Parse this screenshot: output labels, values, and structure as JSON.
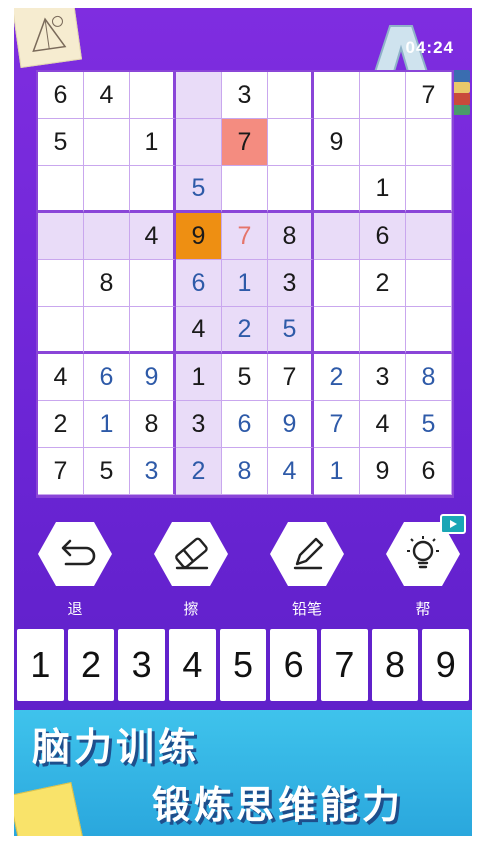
{
  "timer": "04:24",
  "grid": [
    [
      {
        "v": "6"
      },
      {
        "v": "4"
      },
      {
        "v": ""
      },
      {
        "v": "",
        "hl": true
      },
      {
        "v": "3"
      },
      {
        "v": ""
      },
      {
        "v": ""
      },
      {
        "v": ""
      },
      {
        "v": "7"
      }
    ],
    [
      {
        "v": "5"
      },
      {
        "v": ""
      },
      {
        "v": "1"
      },
      {
        "v": "",
        "hl": true
      },
      {
        "v": "7",
        "err": true
      },
      {
        "v": ""
      },
      {
        "v": "9"
      },
      {
        "v": ""
      },
      {
        "v": ""
      }
    ],
    [
      {
        "v": ""
      },
      {
        "v": ""
      },
      {
        "v": ""
      },
      {
        "v": "5",
        "user": true,
        "hl": true
      },
      {
        "v": ""
      },
      {
        "v": ""
      },
      {
        "v": ""
      },
      {
        "v": "1"
      },
      {
        "v": ""
      }
    ],
    [
      {
        "v": "",
        "hl": true
      },
      {
        "v": "",
        "hl": true
      },
      {
        "v": "4",
        "hl": true
      },
      {
        "v": "9",
        "sel": true
      },
      {
        "v": "7",
        "errtext": true,
        "hl": true
      },
      {
        "v": "8",
        "hl": true
      },
      {
        "v": "",
        "hl": true
      },
      {
        "v": "6",
        "hl": true
      },
      {
        "v": "",
        "hl": true
      }
    ],
    [
      {
        "v": ""
      },
      {
        "v": "8"
      },
      {
        "v": ""
      },
      {
        "v": "6",
        "user": true,
        "hl": true
      },
      {
        "v": "1",
        "user": true,
        "hl": true
      },
      {
        "v": "3",
        "hl": true
      },
      {
        "v": ""
      },
      {
        "v": "2"
      },
      {
        "v": ""
      }
    ],
    [
      {
        "v": ""
      },
      {
        "v": ""
      },
      {
        "v": ""
      },
      {
        "v": "4",
        "hl": true
      },
      {
        "v": "2",
        "user": true,
        "hl": true
      },
      {
        "v": "5",
        "user": true,
        "hl": true
      },
      {
        "v": ""
      },
      {
        "v": ""
      },
      {
        "v": ""
      }
    ],
    [
      {
        "v": "4"
      },
      {
        "v": "6",
        "user": true
      },
      {
        "v": "9",
        "user": true
      },
      {
        "v": "1",
        "hl": true
      },
      {
        "v": "5"
      },
      {
        "v": "7"
      },
      {
        "v": "2",
        "user": true
      },
      {
        "v": "3"
      },
      {
        "v": "8",
        "user": true
      }
    ],
    [
      {
        "v": "2"
      },
      {
        "v": "1",
        "user": true
      },
      {
        "v": "8"
      },
      {
        "v": "3",
        "hl": true
      },
      {
        "v": "6",
        "user": true
      },
      {
        "v": "9",
        "user": true
      },
      {
        "v": "7",
        "user": true
      },
      {
        "v": "4"
      },
      {
        "v": "5",
        "user": true
      }
    ],
    [
      {
        "v": "7"
      },
      {
        "v": "5"
      },
      {
        "v": "3",
        "user": true
      },
      {
        "v": "2",
        "user": true,
        "hl": true
      },
      {
        "v": "8",
        "user": true
      },
      {
        "v": "4",
        "user": true
      },
      {
        "v": "1",
        "user": true
      },
      {
        "v": "9"
      },
      {
        "v": "6"
      }
    ]
  ],
  "tools": {
    "undo": {
      "label": "退",
      "icon": "undo-icon"
    },
    "erase": {
      "label": "擦",
      "icon": "eraser-icon"
    },
    "pencil": {
      "label": "铅笔",
      "icon": "pencil-icon"
    },
    "hint": {
      "label": "帮",
      "icon": "lightbulb-icon"
    }
  },
  "numpad": [
    "1",
    "2",
    "3",
    "4",
    "5",
    "6",
    "7",
    "8",
    "9"
  ],
  "banner": {
    "line1": "脑力训练",
    "line2": "锻炼思维能力"
  },
  "colors": {
    "background": "#6a24d4",
    "selected": "#ee8f12",
    "error": "#f48c80",
    "user_digit": "#2e5aa8",
    "banner": "#2aa7dd"
  }
}
